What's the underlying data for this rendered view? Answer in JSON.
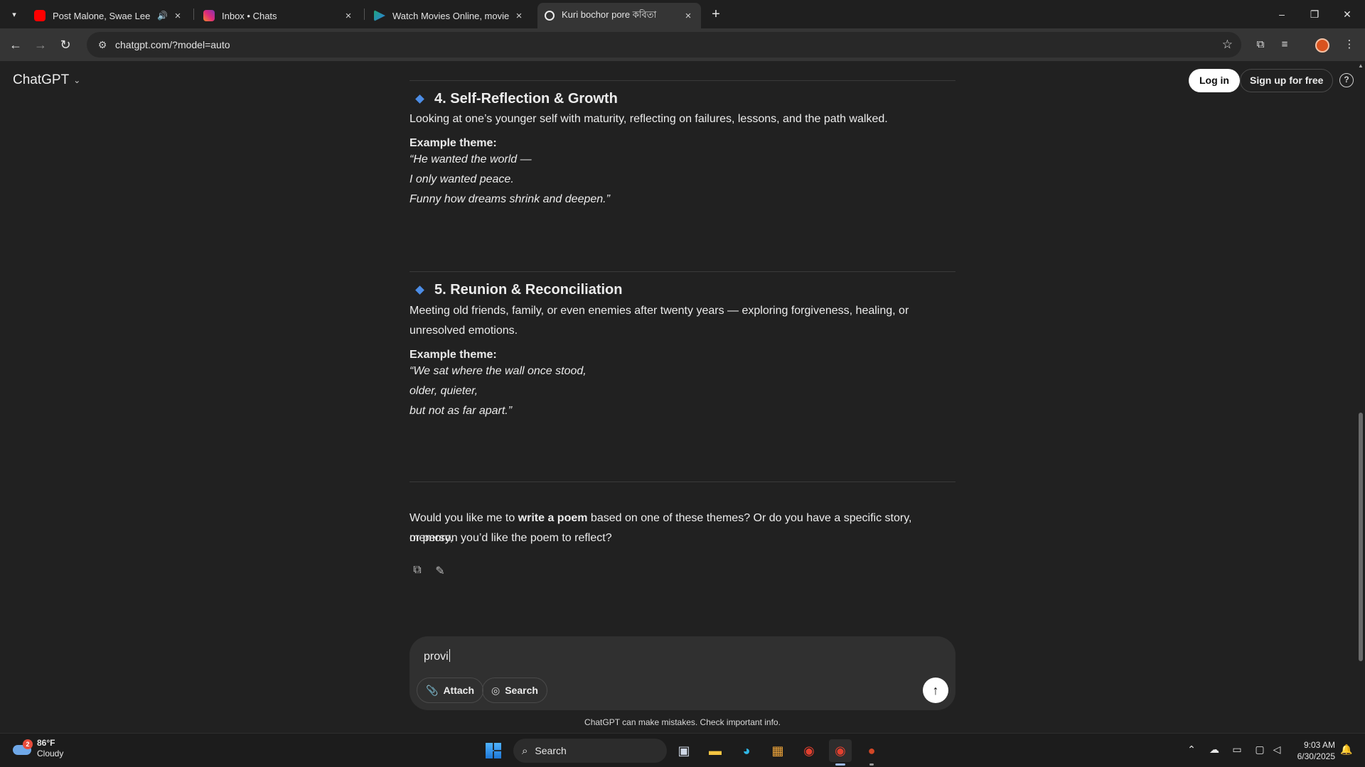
{
  "browser": {
    "tabs": [
      {
        "title": "Post Malone, Swae Lee - Su",
        "audio": "🔊",
        "active": false,
        "favicon_color": "#ff0000"
      },
      {
        "title": "Inbox • Chats",
        "active": false,
        "favicon_color": "#d6249f"
      },
      {
        "title": "Watch Movies Online, movies s",
        "active": false,
        "favicon_color": "#1fa67a"
      },
      {
        "title": "Kuri bochor pore কবিতা",
        "active": true,
        "favicon_color": "#ececec"
      }
    ],
    "close_glyph": "×",
    "new_tab_glyph": "+",
    "url": "chatgpt.com/?model=auto",
    "window_controls": {
      "minimize": "–",
      "restore": "❐",
      "close": "✕"
    }
  },
  "header": {
    "brand": "ChatGPT",
    "login": "Log in",
    "signup": "Sign up for free",
    "help": "?"
  },
  "sections": [
    {
      "heading": "4. Self-Reflection & Growth",
      "body": "Looking at one’s younger self with maturity, reflecting on failures, lessons, and the path walked.",
      "example_label": "Example theme:",
      "lines": [
        "“He wanted the world —",
        "I only wanted peace.",
        "Funny how dreams shrink and deepen.”"
      ]
    },
    {
      "heading": "5. Reunion & Reconciliation",
      "body_line1": "Meeting old friends, family, or even enemies after twenty years — exploring forgiveness, healing, or",
      "body_line2": "unresolved emotions.",
      "example_label": "Example theme:",
      "lines": [
        "“We sat where the wall once stood,",
        "older, quieter,",
        "but not as far apart.”"
      ]
    }
  ],
  "closing": {
    "pre": "Would you like me to ",
    "bold": "write a poem",
    "post": " based on one of these themes? Or do you have a specific story, memory,",
    "line2": "or person you’d like the poem to reflect?"
  },
  "composer": {
    "value": "provi",
    "attach_label": "Attach",
    "search_label": "Search"
  },
  "disclaimer": "ChatGPT can make mistakes. Check important info.",
  "taskbar": {
    "weather_badge": "2",
    "temperature": "86°F",
    "condition": "Cloudy",
    "search_label": "Search",
    "time": "9:03 AM",
    "date": "6/30/2025"
  },
  "colors": {
    "page_bg": "#212121",
    "accent_diamond": "#4c8de6",
    "composer_bg": "#303030"
  }
}
